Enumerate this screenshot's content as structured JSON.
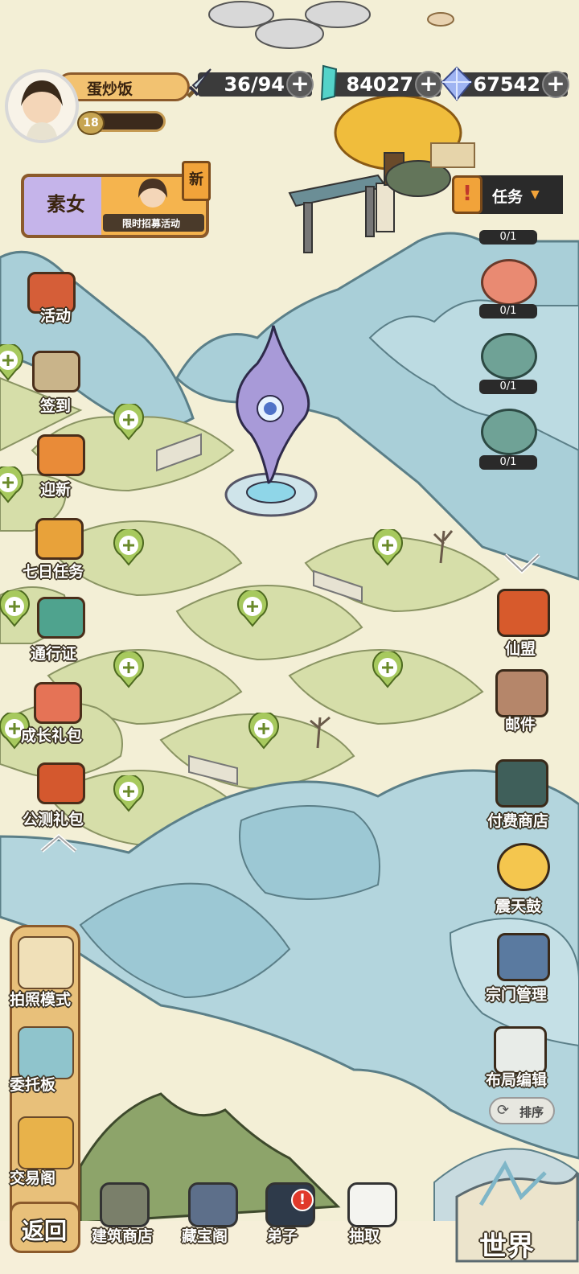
{
  "player": {
    "name": "蛋炒饭",
    "level": "18"
  },
  "resources": {
    "stamina": "36/94",
    "jade": "84027",
    "crystal": "67542"
  },
  "event_banner": {
    "title": "素女",
    "subtitle": "限时招募活动",
    "badge": "新"
  },
  "quest": {
    "label": "任务",
    "rows": [
      "0/1",
      "0/1",
      "0/1",
      "0/1"
    ]
  },
  "left_menu": [
    {
      "label": "活动",
      "icon": "banner-flag-icon"
    },
    {
      "label": "签到",
      "icon": "sign-scroll-icon"
    },
    {
      "label": "迎新",
      "icon": "seven-welcome-icon"
    },
    {
      "label": "七日任务",
      "icon": "seven-day-icon"
    },
    {
      "label": "通行证",
      "icon": "pass-medal-icon"
    },
    {
      "label": "成长礼包",
      "icon": "growth-gift-icon"
    },
    {
      "label": "公测礼包",
      "icon": "beta-gift-icon"
    }
  ],
  "right_menu": [
    {
      "label": "仙盟",
      "icon": "alliance-banner-icon"
    },
    {
      "label": "邮件",
      "icon": "mail-letter-icon"
    },
    {
      "label": "付费商店",
      "icon": "shop-merchant-icon"
    },
    {
      "label": "震天鼓",
      "icon": "drum-icon"
    },
    {
      "label": "宗门管理",
      "icon": "sect-manager-icon"
    },
    {
      "label": "布局编辑",
      "icon": "layout-edit-icon"
    }
  ],
  "sort_button": "排序",
  "side_tools": [
    {
      "label": "拍照模式"
    },
    {
      "label": "委托板"
    },
    {
      "label": "交易阁"
    }
  ],
  "bottom_nav": {
    "back": "返回",
    "items": [
      "建筑商店",
      "藏宝阁",
      "弟子",
      "抽取"
    ],
    "world": "世界"
  },
  "colors": {
    "parchment": "#f3efd6",
    "mountain_blue": "#9cc8d4",
    "hill_green": "#cdd89e",
    "gold": "#e8b24a",
    "dark_bar": "#3b3b3b"
  }
}
